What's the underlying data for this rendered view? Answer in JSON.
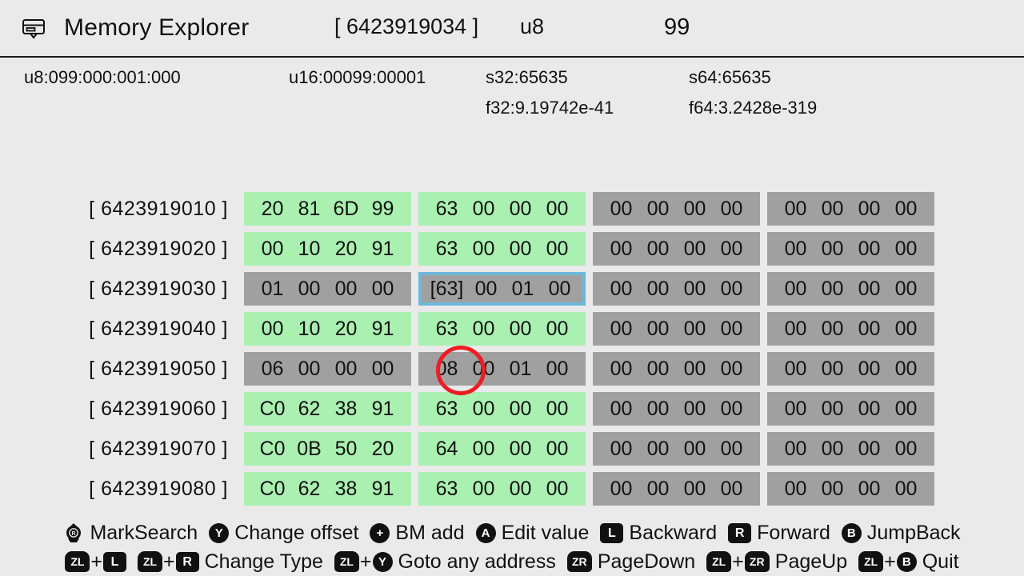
{
  "titlebar": {
    "icon": "memory-window-icon",
    "title": "Memory Explorer",
    "address": "[ 6423919034 ]",
    "type": "u8",
    "value": "99"
  },
  "info": {
    "u8": "u8:099:000:001:000",
    "u16": "u16:00099:00001",
    "s32": "s32:65635",
    "s64": "s64:65635",
    "f32": "f32:9.19742e-41",
    "f64": "f64:3.2428e-319"
  },
  "grid": {
    "selection": {
      "row": 2,
      "group": 1,
      "byte": 0
    },
    "rows": [
      {
        "address": "[ 6423919010 ]",
        "groups": [
          {
            "style": "green",
            "bytes": [
              "20",
              "81",
              "6D",
              "99"
            ]
          },
          {
            "style": "green",
            "bytes": [
              "63",
              "00",
              "00",
              "00"
            ]
          },
          {
            "style": "gray",
            "bytes": [
              "00",
              "00",
              "00",
              "00"
            ]
          },
          {
            "style": "gray",
            "bytes": [
              "00",
              "00",
              "00",
              "00"
            ]
          }
        ]
      },
      {
        "address": "[ 6423919020 ]",
        "groups": [
          {
            "style": "green",
            "bytes": [
              "00",
              "10",
              "20",
              "91"
            ]
          },
          {
            "style": "green",
            "bytes": [
              "63",
              "00",
              "00",
              "00"
            ]
          },
          {
            "style": "gray",
            "bytes": [
              "00",
              "00",
              "00",
              "00"
            ]
          },
          {
            "style": "gray",
            "bytes": [
              "00",
              "00",
              "00",
              "00"
            ]
          }
        ]
      },
      {
        "address": "[ 6423919030 ]",
        "groups": [
          {
            "style": "gray",
            "bytes": [
              "01",
              "00",
              "00",
              "00"
            ]
          },
          {
            "style": "gray",
            "bytes": [
              "[63]",
              "00",
              "01",
              "00"
            ],
            "selected": true
          },
          {
            "style": "gray",
            "bytes": [
              "00",
              "00",
              "00",
              "00"
            ]
          },
          {
            "style": "gray",
            "bytes": [
              "00",
              "00",
              "00",
              "00"
            ]
          }
        ]
      },
      {
        "address": "[ 6423919040 ]",
        "groups": [
          {
            "style": "green",
            "bytes": [
              "00",
              "10",
              "20",
              "91"
            ]
          },
          {
            "style": "green",
            "bytes": [
              "63",
              "00",
              "00",
              "00"
            ]
          },
          {
            "style": "gray",
            "bytes": [
              "00",
              "00",
              "00",
              "00"
            ]
          },
          {
            "style": "gray",
            "bytes": [
              "00",
              "00",
              "00",
              "00"
            ]
          }
        ]
      },
      {
        "address": "[ 6423919050 ]",
        "groups": [
          {
            "style": "gray",
            "bytes": [
              "06",
              "00",
              "00",
              "00"
            ]
          },
          {
            "style": "gray",
            "bytes": [
              "08",
              "00",
              "01",
              "00"
            ]
          },
          {
            "style": "gray",
            "bytes": [
              "00",
              "00",
              "00",
              "00"
            ]
          },
          {
            "style": "gray",
            "bytes": [
              "00",
              "00",
              "00",
              "00"
            ]
          }
        ]
      },
      {
        "address": "[ 6423919060 ]",
        "groups": [
          {
            "style": "green",
            "bytes": [
              "C0",
              "62",
              "38",
              "91"
            ]
          },
          {
            "style": "green",
            "bytes": [
              "63",
              "00",
              "00",
              "00"
            ]
          },
          {
            "style": "gray",
            "bytes": [
              "00",
              "00",
              "00",
              "00"
            ]
          },
          {
            "style": "gray",
            "bytes": [
              "00",
              "00",
              "00",
              "00"
            ]
          }
        ]
      },
      {
        "address": "[ 6423919070 ]",
        "groups": [
          {
            "style": "green",
            "bytes": [
              "C0",
              "0B",
              "50",
              "20"
            ]
          },
          {
            "style": "green",
            "bytes": [
              "64",
              "00",
              "00",
              "00"
            ]
          },
          {
            "style": "gray",
            "bytes": [
              "00",
              "00",
              "00",
              "00"
            ]
          },
          {
            "style": "gray",
            "bytes": [
              "00",
              "00",
              "00",
              "00"
            ]
          }
        ]
      },
      {
        "address": "[ 6423919080 ]",
        "groups": [
          {
            "style": "green",
            "bytes": [
              "C0",
              "62",
              "38",
              "91"
            ]
          },
          {
            "style": "green",
            "bytes": [
              "63",
              "00",
              "00",
              "00"
            ]
          },
          {
            "style": "gray",
            "bytes": [
              "00",
              "00",
              "00",
              "00"
            ]
          },
          {
            "style": "gray",
            "bytes": [
              "00",
              "00",
              "00",
              "00"
            ]
          }
        ]
      }
    ]
  },
  "annotation": {
    "type": "red-circle",
    "target_byte": "08"
  },
  "footer": {
    "lines": [
      [
        {
          "keys": [
            {
              "glyph": "stick",
              "name": "right-stick-icon",
              "text": ""
            }
          ],
          "label": "MarkSearch"
        },
        {
          "keys": [
            {
              "glyph": "circle",
              "name": "button-y-icon",
              "text": "Y"
            }
          ],
          "label": "Change offset"
        },
        {
          "keys": [
            {
              "glyph": "circle",
              "name": "button-plus-icon",
              "text": "+"
            }
          ],
          "label": "BM add"
        },
        {
          "keys": [
            {
              "glyph": "circle",
              "name": "button-a-icon",
              "text": "A"
            }
          ],
          "label": "Edit value"
        },
        {
          "keys": [
            {
              "glyph": "square",
              "name": "button-l-icon",
              "text": "L"
            }
          ],
          "label": "Backward"
        },
        {
          "keys": [
            {
              "glyph": "square",
              "name": "button-r-icon",
              "text": "R"
            }
          ],
          "label": "Forward"
        },
        {
          "keys": [
            {
              "glyph": "circle",
              "name": "button-b-icon",
              "text": "B"
            }
          ],
          "label": "JumpBack"
        }
      ],
      [
        {
          "keys": [
            {
              "glyph": "trigger",
              "name": "button-zl-icon",
              "text": "ZL"
            },
            {
              "glyph": "square",
              "name": "button-l-icon",
              "text": "L"
            }
          ],
          "label": ""
        },
        {
          "keys": [
            {
              "glyph": "trigger",
              "name": "button-zl-icon",
              "text": "ZL"
            },
            {
              "glyph": "square",
              "name": "button-r-icon",
              "text": "R"
            }
          ],
          "label": "Change Type"
        },
        {
          "keys": [
            {
              "glyph": "trigger",
              "name": "button-zl-icon",
              "text": "ZL"
            },
            {
              "glyph": "circle",
              "name": "button-y-icon",
              "text": "Y"
            }
          ],
          "label": "Goto any address"
        },
        {
          "keys": [
            {
              "glyph": "trigger",
              "name": "button-zr-icon",
              "text": "ZR"
            }
          ],
          "label": "PageDown"
        },
        {
          "keys": [
            {
              "glyph": "trigger",
              "name": "button-zl-icon",
              "text": "ZL"
            },
            {
              "glyph": "trigger",
              "name": "button-zr-icon",
              "text": "ZR"
            }
          ],
          "label": "PageUp"
        },
        {
          "keys": [
            {
              "glyph": "trigger",
              "name": "button-zl-icon",
              "text": "ZL"
            },
            {
              "glyph": "circle",
              "name": "button-b-icon",
              "text": "B"
            }
          ],
          "label": "Quit"
        }
      ]
    ]
  },
  "colors": {
    "background": "#eaeaea",
    "green_cell": "#a9f0b1",
    "gray_cell": "#a0a0a0",
    "selection_border": "#6cb9da",
    "annotation_red": "#ee1c24",
    "text": "#111111"
  }
}
